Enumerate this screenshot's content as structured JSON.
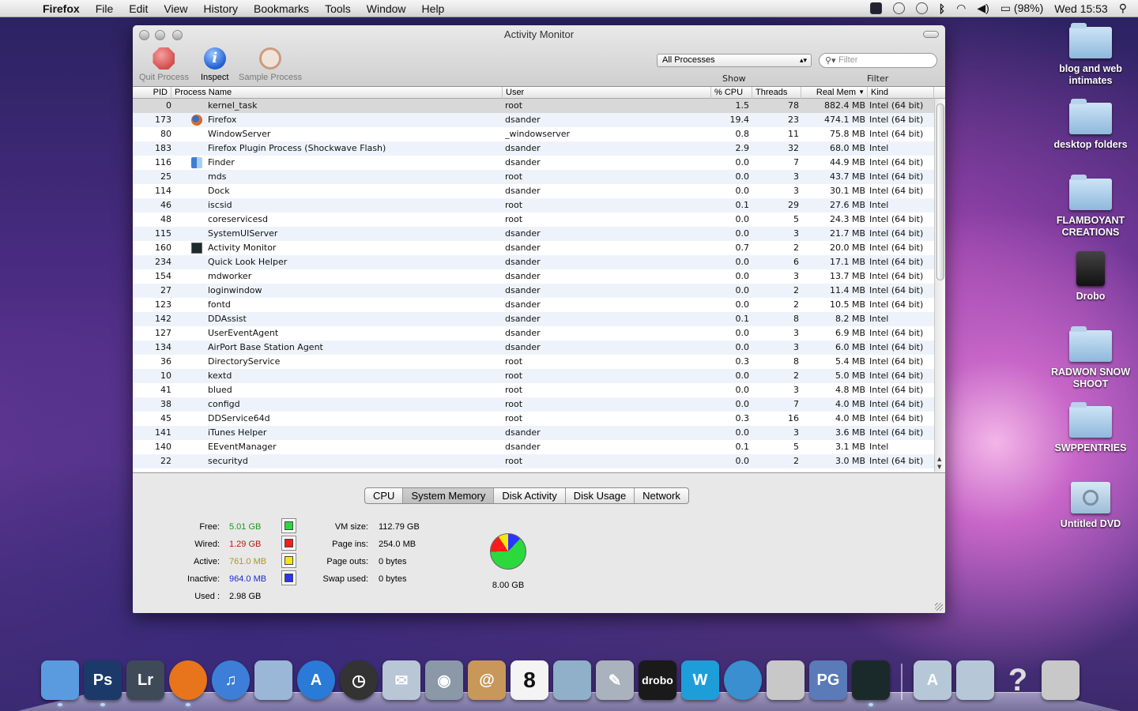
{
  "menubar": {
    "apple_glyph": "",
    "app_name": "Firefox",
    "menus": [
      "File",
      "Edit",
      "View",
      "History",
      "Bookmarks",
      "Tools",
      "Window",
      "Help"
    ],
    "battery": "(98%)",
    "clock": "Wed 15:53",
    "status_icons": [
      "screen-icon",
      "sync-icon",
      "time-machine-icon",
      "bluetooth-icon",
      "wifi-icon",
      "volume-icon",
      "battery-icon",
      "spotlight-icon"
    ]
  },
  "window": {
    "title": "Activity Monitor",
    "toolbar": {
      "quit": "Quit Process",
      "inspect": "Inspect",
      "sample": "Sample Process"
    },
    "process_filter_select": "All Processes",
    "filter_placeholder": "Filter",
    "show_label": "Show",
    "filter_label": "Filter",
    "columns": [
      "PID",
      "Process Name",
      "User",
      "% CPU",
      "Threads",
      "Real Mem",
      "Kind"
    ],
    "sort_indicator": "▼",
    "processes": [
      {
        "pid": "0",
        "name": "kernel_task",
        "user": "root",
        "cpu": "1.5",
        "threads": "78",
        "mem": "882.4 MB",
        "kind": "Intel (64 bit)",
        "icon": ""
      },
      {
        "pid": "173",
        "name": "Firefox",
        "user": "dsander",
        "cpu": "19.4",
        "threads": "23",
        "mem": "474.1 MB",
        "kind": "Intel (64 bit)",
        "icon": "firefox-icon"
      },
      {
        "pid": "80",
        "name": "WindowServer",
        "user": "_windowserver",
        "cpu": "0.8",
        "threads": "11",
        "mem": "75.8 MB",
        "kind": "Intel (64 bit)",
        "icon": ""
      },
      {
        "pid": "183",
        "name": "Firefox Plugin Process (Shockwave Flash)",
        "user": "dsander",
        "cpu": "2.9",
        "threads": "32",
        "mem": "68.0 MB",
        "kind": "Intel",
        "icon": ""
      },
      {
        "pid": "116",
        "name": "Finder",
        "user": "dsander",
        "cpu": "0.0",
        "threads": "7",
        "mem": "44.9 MB",
        "kind": "Intel (64 bit)",
        "icon": "finder-icon"
      },
      {
        "pid": "25",
        "name": "mds",
        "user": "root",
        "cpu": "0.0",
        "threads": "3",
        "mem": "43.7 MB",
        "kind": "Intel (64 bit)",
        "icon": ""
      },
      {
        "pid": "114",
        "name": "Dock",
        "user": "dsander",
        "cpu": "0.0",
        "threads": "3",
        "mem": "30.1 MB",
        "kind": "Intel (64 bit)",
        "icon": ""
      },
      {
        "pid": "46",
        "name": "iscsid",
        "user": "root",
        "cpu": "0.1",
        "threads": "29",
        "mem": "27.6 MB",
        "kind": "Intel",
        "icon": ""
      },
      {
        "pid": "48",
        "name": "coreservicesd",
        "user": "root",
        "cpu": "0.0",
        "threads": "5",
        "mem": "24.3 MB",
        "kind": "Intel (64 bit)",
        "icon": ""
      },
      {
        "pid": "115",
        "name": "SystemUIServer",
        "user": "dsander",
        "cpu": "0.0",
        "threads": "3",
        "mem": "21.7 MB",
        "kind": "Intel (64 bit)",
        "icon": ""
      },
      {
        "pid": "160",
        "name": "Activity Monitor",
        "user": "dsander",
        "cpu": "0.7",
        "threads": "2",
        "mem": "20.0 MB",
        "kind": "Intel (64 bit)",
        "icon": "activity-monitor-icon"
      },
      {
        "pid": "234",
        "name": "Quick Look Helper",
        "user": "dsander",
        "cpu": "0.0",
        "threads": "6",
        "mem": "17.1 MB",
        "kind": "Intel (64 bit)",
        "icon": ""
      },
      {
        "pid": "154",
        "name": "mdworker",
        "user": "dsander",
        "cpu": "0.0",
        "threads": "3",
        "mem": "13.7 MB",
        "kind": "Intel (64 bit)",
        "icon": ""
      },
      {
        "pid": "27",
        "name": "loginwindow",
        "user": "dsander",
        "cpu": "0.0",
        "threads": "2",
        "mem": "11.4 MB",
        "kind": "Intel (64 bit)",
        "icon": ""
      },
      {
        "pid": "123",
        "name": "fontd",
        "user": "dsander",
        "cpu": "0.0",
        "threads": "2",
        "mem": "10.5 MB",
        "kind": "Intel (64 bit)",
        "icon": ""
      },
      {
        "pid": "142",
        "name": "DDAssist",
        "user": "dsander",
        "cpu": "0.1",
        "threads": "8",
        "mem": "8.2 MB",
        "kind": "Intel",
        "icon": ""
      },
      {
        "pid": "127",
        "name": "UserEventAgent",
        "user": "dsander",
        "cpu": "0.0",
        "threads": "3",
        "mem": "6.9 MB",
        "kind": "Intel (64 bit)",
        "icon": ""
      },
      {
        "pid": "134",
        "name": "AirPort Base Station Agent",
        "user": "dsander",
        "cpu": "0.0",
        "threads": "3",
        "mem": "6.0 MB",
        "kind": "Intel (64 bit)",
        "icon": ""
      },
      {
        "pid": "36",
        "name": "DirectoryService",
        "user": "root",
        "cpu": "0.3",
        "threads": "8",
        "mem": "5.4 MB",
        "kind": "Intel (64 bit)",
        "icon": ""
      },
      {
        "pid": "10",
        "name": "kextd",
        "user": "root",
        "cpu": "0.0",
        "threads": "2",
        "mem": "5.0 MB",
        "kind": "Intel (64 bit)",
        "icon": ""
      },
      {
        "pid": "41",
        "name": "blued",
        "user": "root",
        "cpu": "0.0",
        "threads": "3",
        "mem": "4.8 MB",
        "kind": "Intel (64 bit)",
        "icon": ""
      },
      {
        "pid": "38",
        "name": "configd",
        "user": "root",
        "cpu": "0.0",
        "threads": "7",
        "mem": "4.0 MB",
        "kind": "Intel (64 bit)",
        "icon": ""
      },
      {
        "pid": "45",
        "name": "DDService64d",
        "user": "root",
        "cpu": "0.3",
        "threads": "16",
        "mem": "4.0 MB",
        "kind": "Intel (64 bit)",
        "icon": ""
      },
      {
        "pid": "141",
        "name": "iTunes Helper",
        "user": "dsander",
        "cpu": "0.0",
        "threads": "3",
        "mem": "3.6 MB",
        "kind": "Intel (64 bit)",
        "icon": ""
      },
      {
        "pid": "140",
        "name": "EEventManager",
        "user": "dsander",
        "cpu": "0.1",
        "threads": "5",
        "mem": "3.1 MB",
        "kind": "Intel",
        "icon": ""
      },
      {
        "pid": "22",
        "name": "securityd",
        "user": "root",
        "cpu": "0.0",
        "threads": "2",
        "mem": "3.0 MB",
        "kind": "Intel (64 bit)",
        "icon": ""
      }
    ],
    "tabs": [
      "CPU",
      "System Memory",
      "Disk Activity",
      "Disk Usage",
      "Network"
    ],
    "active_tab": "System Memory",
    "memory": {
      "free_label": "Free:",
      "free": "5.01 GB",
      "free_color": "#1a9a1a",
      "free_swatch": "#2bd93d",
      "wired_label": "Wired:",
      "wired": "1.29 GB",
      "wired_color": "#c41414",
      "wired_swatch": "#ff1b1b",
      "active_label": "Active:",
      "active": "761.0 MB",
      "active_color": "#a89a1a",
      "active_swatch": "#f4e80d",
      "inactive_label": "Inactive:",
      "inactive": "964.0 MB",
      "inactive_color": "#1a2ad0",
      "inactive_swatch": "#2a36ff",
      "used_label": "Used :",
      "used": "2.98 GB",
      "vmsize_label": "VM size:",
      "vmsize": "112.79 GB",
      "pageins_label": "Page ins:",
      "pageins": "254.0 MB",
      "pageouts_label": "Page outs:",
      "pageouts": "0 bytes",
      "swap_label": "Swap used:",
      "swap": "0 bytes",
      "total": "8.00 GB"
    }
  },
  "desktop": [
    {
      "label": "blog and web intimates",
      "kind": "folder"
    },
    {
      "label": "desktop folders",
      "kind": "folder"
    },
    {
      "label": "FLAMBOYANT CREATIONS",
      "kind": "folder"
    },
    {
      "label": "Drobo",
      "kind": "drive"
    },
    {
      "label": "RADWON SNOW SHOOT",
      "kind": "folder"
    },
    {
      "label": "SWPPENTRIES",
      "kind": "folder"
    },
    {
      "label": "Untitled DVD",
      "kind": "dvd"
    }
  ],
  "dock": [
    {
      "name": "finder-icon",
      "text": "",
      "bg": "#5a9be0",
      "running": true
    },
    {
      "name": "photoshop-icon",
      "text": "Ps",
      "bg": "#1b3a6a",
      "running": true
    },
    {
      "name": "lightroom-icon",
      "text": "Lr",
      "bg": "#3f4a58",
      "running": false
    },
    {
      "name": "firefox-icon",
      "text": "",
      "bg": "#e8741c",
      "running": true,
      "round": true
    },
    {
      "name": "itunes-icon",
      "text": "♫",
      "bg": "#3d7fd8",
      "running": false,
      "round": true
    },
    {
      "name": "parallels-icon",
      "text": "",
      "bg": "#9bb7d8",
      "running": false
    },
    {
      "name": "app-store-icon",
      "text": "A",
      "bg": "#2a7ad8",
      "running": false,
      "round": true
    },
    {
      "name": "dashboard-icon",
      "text": "◷",
      "bg": "#333",
      "running": false,
      "round": true
    },
    {
      "name": "mail-icon",
      "text": "✉",
      "bg": "#b9c6d6",
      "running": false
    },
    {
      "name": "facetime-icon",
      "text": "◉",
      "bg": "#8a98a8",
      "running": false
    },
    {
      "name": "address-book-icon",
      "text": "@",
      "bg": "#c8985a",
      "running": false
    },
    {
      "name": "ical-icon",
      "text": "8",
      "bg": "#f4f4f4",
      "running": false
    },
    {
      "name": "iphoto-icon",
      "text": "",
      "bg": "#8fb0c8",
      "running": false
    },
    {
      "name": "script-editor-icon",
      "text": "✎",
      "bg": "#aab2be",
      "running": false
    },
    {
      "name": "drobo-icon",
      "text": "drobo",
      "bg": "#1a1a1a",
      "running": false
    },
    {
      "name": "word-icon",
      "text": "W",
      "bg": "#1e9ed8",
      "running": false
    },
    {
      "name": "network-icon",
      "text": "",
      "bg": "#3a8fd0",
      "running": false,
      "round": true
    },
    {
      "name": "satellite-icon",
      "text": "",
      "bg": "#c8c8c8",
      "running": false
    },
    {
      "name": "pg-icon",
      "text": "PG",
      "bg": "#5a7ab8",
      "running": false
    },
    {
      "name": "activity-monitor-icon",
      "text": "",
      "bg": "#1a2a2a",
      "running": true
    },
    {
      "name": "applications-folder-icon",
      "text": "A",
      "bg": "#b6c8d8",
      "running": false
    },
    {
      "name": "documents-folder-icon",
      "text": "",
      "bg": "#b6c8d8",
      "running": false
    },
    {
      "name": "help-icon",
      "text": "?",
      "bg": "rgba(0,0,0,0)",
      "running": false
    },
    {
      "name": "trash-icon",
      "text": "",
      "bg": "#c8c8c8",
      "running": false
    }
  ]
}
